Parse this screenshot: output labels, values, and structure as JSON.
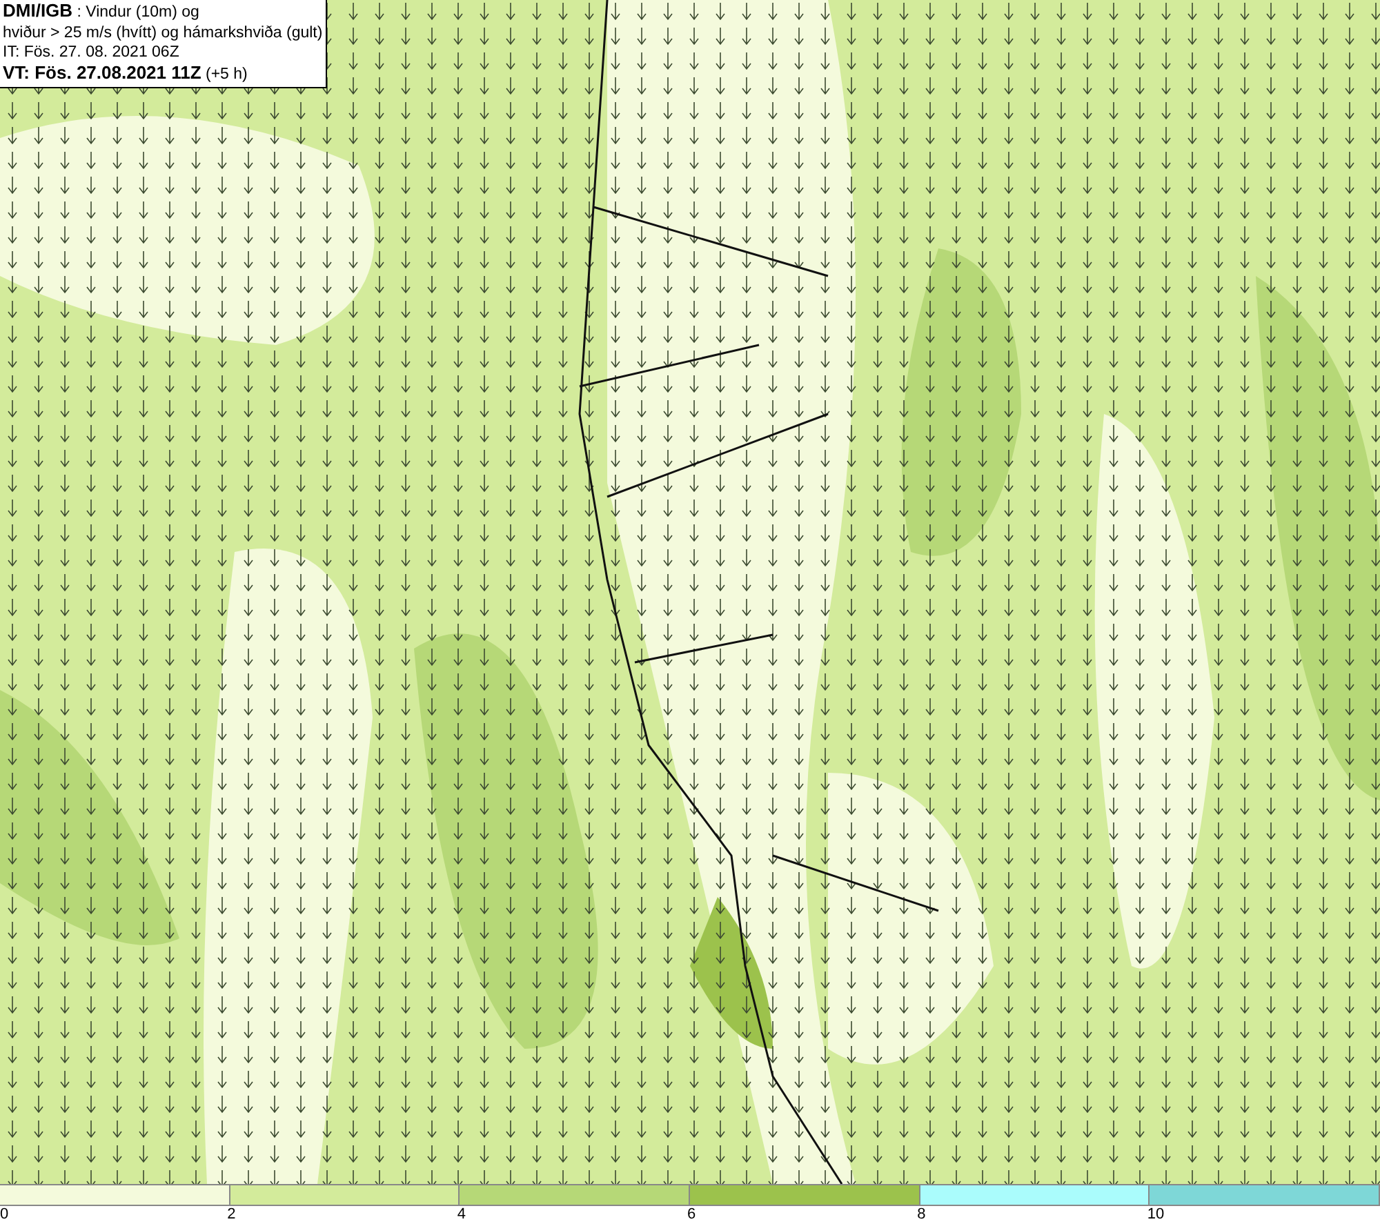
{
  "header": {
    "lines": [
      "**DMI/IGB** : Vindur (10m) og",
      "hviður > 25 m/s (hvítt) og hámarkshviða (gult)",
      "IT: Fös. 27. 08. 2021 06Z",
      "**VT: Fös. 27.08.2021 11Z** (+5 h)"
    ]
  },
  "legend": {
    "bins": [
      {
        "label": "0",
        "color": "#f4fadc"
      },
      {
        "label": "2",
        "color": "#d3eb9b"
      },
      {
        "label": "4",
        "color": "#b6d877"
      },
      {
        "label": "6",
        "color": "#9cc24c"
      },
      {
        "label": "8",
        "color": "#aafcfc"
      },
      {
        "label": "10",
        "color": "#7ed7d7"
      }
    ]
  }
}
